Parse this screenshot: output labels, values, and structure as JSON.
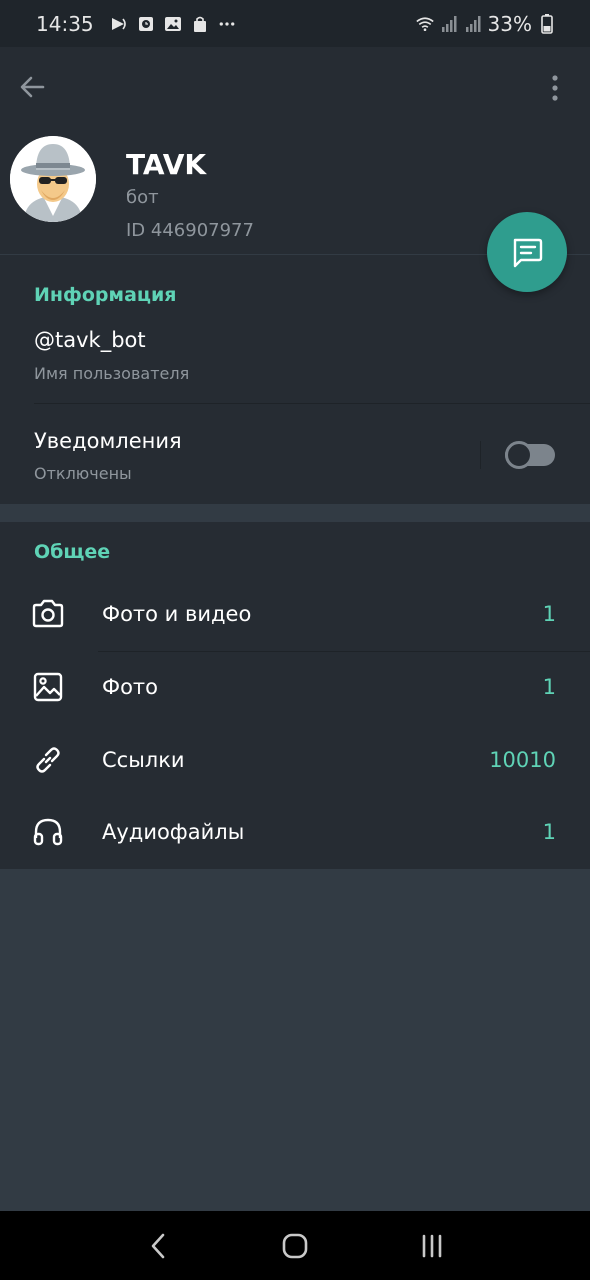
{
  "status_bar": {
    "time": "14:35",
    "battery": "33%"
  },
  "header": {
    "back_icon": "arrow-left-icon",
    "more_icon": "more-vertical-icon"
  },
  "profile": {
    "name": "TAVK",
    "subtitle": "бот",
    "id_text": "ID 446907977",
    "avatar_icon": "spy-avatar-icon"
  },
  "fab": {
    "icon": "message-icon",
    "color": "#2f9d8e"
  },
  "info": {
    "title": "Информация",
    "username": "@tavk_bot",
    "username_label": "Имя пользователя",
    "notifications_title": "Уведомления",
    "notifications_status": "Отключены",
    "notifications_enabled": false
  },
  "general": {
    "title": "Общее",
    "items": [
      {
        "label": "Фото и видео",
        "count": "1",
        "icon": "camera-icon"
      },
      {
        "label": "Фото",
        "count": "1",
        "icon": "image-icon"
      },
      {
        "label": "Ссылки",
        "count": "10010",
        "icon": "link-icon"
      },
      {
        "label": "Аудиофайлы",
        "count": "1",
        "icon": "headphones-icon"
      }
    ]
  },
  "colors": {
    "accent": "#5fd3b6",
    "panel": "#262c33",
    "background": "#323b44"
  }
}
